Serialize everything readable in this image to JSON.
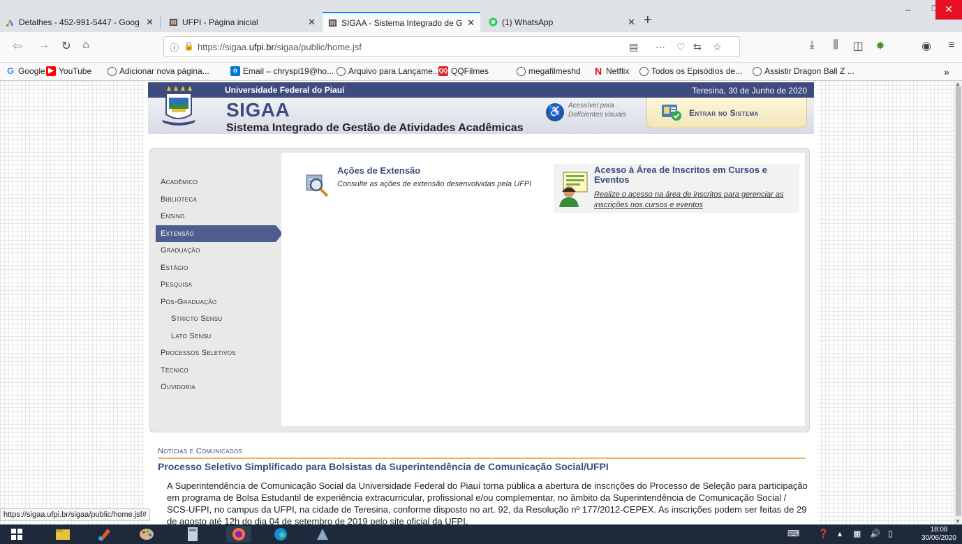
{
  "browser": {
    "tabs": [
      {
        "label": "Detalhes - 452-991-5447 - Goog",
        "active": false
      },
      {
        "label": "UFPI - Página inicial",
        "active": false
      },
      {
        "label": "SIGAA - Sistema Integrado de G",
        "active": true
      },
      {
        "label": "(1) WhatsApp",
        "active": false
      }
    ],
    "url_prefix": "https://sigaa.",
    "url_domain": "ufpi.br",
    "url_path": "/sigaa/public/home.jsf",
    "bookmarks": [
      "Google",
      "YouTube",
      "Adicionar nova página...",
      "Email – chryspi19@ho...",
      "Arquivo para Lançame...",
      "QQFilmes",
      "megafilmeshd",
      "Netflix",
      "Todos os Episódios de...",
      "Assistir Dragon Ball Z ..."
    ],
    "status_url": "https://sigaa.ufpi.br/sigaa/public/home.jsf#"
  },
  "header": {
    "university": "Universidade Federal do Piauí",
    "date": "Teresina, 30 de Junho de 2020",
    "title": "SIGAA",
    "subtitle": "Sistema Integrado de Gestão de Atividades Acadêmicas",
    "access_line1": "Acessível para",
    "access_line2": "Deficientes visuais",
    "login_label": "Entrar no Sistema"
  },
  "menu": [
    {
      "label": "Acadêmico",
      "sub": false,
      "active": false
    },
    {
      "label": "Biblioteca",
      "sub": false,
      "active": false
    },
    {
      "label": "Ensino",
      "sub": false,
      "active": false
    },
    {
      "label": "Extensão",
      "sub": false,
      "active": true
    },
    {
      "label": "Graduação",
      "sub": false,
      "active": false
    },
    {
      "label": "Estágio",
      "sub": false,
      "active": false
    },
    {
      "label": "Pesquisa",
      "sub": false,
      "active": false
    },
    {
      "label": "Pós-Graduação",
      "sub": false,
      "active": false
    },
    {
      "label": "Stricto Sensu",
      "sub": true,
      "active": false
    },
    {
      "label": "Lato Sensu",
      "sub": true,
      "active": false
    },
    {
      "label": "Processos Seletivos",
      "sub": false,
      "active": false
    },
    {
      "label": "Técnico",
      "sub": false,
      "active": false
    },
    {
      "label": "Ouvidoria",
      "sub": false,
      "active": false
    }
  ],
  "content": {
    "item1_title": "Ações de Extensão",
    "item1_desc": "Consulte as ações de extensão desenvolvidas pela UFPI",
    "item2_title": "Acesso à Área de Inscritos em Cursos e Eventos",
    "item2_desc": "Realize o acesso na área de inscritos para gerenciar as inscrições nos cursos e eventos"
  },
  "news": {
    "heading": "Notícias e Comunicados",
    "title": "Processo Seletivo Simplificado para Bolsistas da Superintendência de Comunicação Social/UFPI",
    "body": "A Superintendência de Comunicação Social da Universidade Federal do Piauí torna pública a abertura de inscrições do Processo de Seleção para participação em programa de Bolsa Estudantil de experiência extracurricular, profissional e/ou complementar, no âmbito da Superintendência de Comunicação Social / SCS-UFPI, no campus da UFPI, na cidade de Teresina, conforme disposto no art. 92, da Resolução nº 177/2012-CEPEX. As inscrições podem ser feitas de 29 de agosto até 12h do dia 04 de setembro de 2019 pelo site oficial da UFPI."
  },
  "taskbar": {
    "time": "18:08",
    "date": "30/06/2020"
  },
  "colors": {
    "brand": "#3e4b7e",
    "menu_active": "#4c5d8e",
    "accent_line": "#e8b466",
    "tab_active_border": "#0a84ff"
  }
}
